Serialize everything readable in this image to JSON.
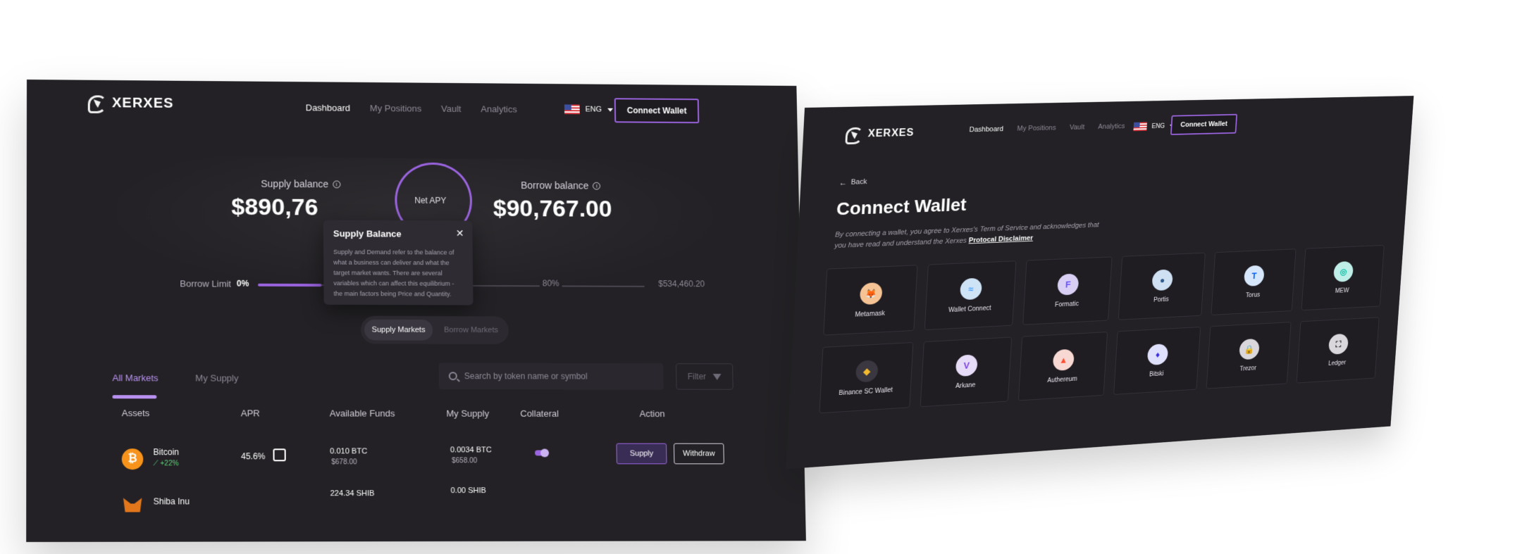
{
  "dashboard": {
    "brand": "XERXES",
    "nav": [
      "Dashboard",
      "My Positions",
      "Vault",
      "Analytics"
    ],
    "lang": "ENG",
    "connect_label": "Connect Wallet",
    "supply_balance_label": "Supply balance",
    "supply_balance_value": "$890,76",
    "net_apy_label": "Net APY",
    "borrow_balance_label": "Borrow balance",
    "borrow_balance_value": "$90,767.00",
    "borrow_limit_label": "Borrow Limit",
    "borrow_limit_pct": "0%",
    "borrow_limit_marker": "80%",
    "borrow_limit_max": "$534,460.20",
    "tooltip": {
      "title": "Supply Balance",
      "body": "Supply and Demand refer to the balance of what a business can deliver and what the target market wants. There are several variables which can affect this equilibrium - the main factors being Price and Quantity."
    },
    "market_toggle": [
      "Supply Markets",
      "Borrow Markets"
    ],
    "tabs": [
      "All Markets",
      "My Supply"
    ],
    "search_placeholder": "Search by token name or symbol",
    "filter_label": "Filter",
    "columns": [
      "Assets",
      "APR",
      "Available Funds",
      "My Supply",
      "Collateral",
      "Action"
    ],
    "rows": [
      {
        "name": "Bitcoin",
        "change": "+22%",
        "apr": "45.6%",
        "funds_token": "0.010 BTC",
        "funds_usd": "$678.00",
        "supply_token": "0.0034 BTC",
        "supply_usd": "$658.00",
        "supply_btn": "Supply",
        "withdraw_btn": "Withdraw"
      },
      {
        "name": "Shiba Inu",
        "funds_token": "224.34 SHIB",
        "supply_token": "0.00 SHIB"
      }
    ]
  },
  "connect_wallet": {
    "brand": "XERXES",
    "nav": [
      "Dashboard",
      "My Positions",
      "Vault",
      "Analytics"
    ],
    "lang": "ENG",
    "connect_label": "Connect Wallet",
    "back_label": "Back",
    "title": "Connect Wallet",
    "description": "By connecting a wallet, you agree to Xerxes's Term of Service and acknowledges that you have read and understand the Xerxes",
    "disclaimer_link": "Protocal Disclaimer",
    "wallets": [
      {
        "name": "Metamask",
        "icon": "fox-icon",
        "color": "#f5c394"
      },
      {
        "name": "Wallet Connect",
        "icon": "wave-icon",
        "color": "#cfe3f6"
      },
      {
        "name": "Formatic",
        "icon": "formatic-icon",
        "color": "#d9cff5"
      },
      {
        "name": "Portis",
        "icon": "drop-icon",
        "color": "#cfe0f2"
      },
      {
        "name": "Torus",
        "icon": "torus-icon",
        "color": "#d6e6fb"
      },
      {
        "name": "MEW",
        "icon": "mew-icon",
        "color": "#bfeee8"
      },
      {
        "name": "Binance SC Wallet",
        "icon": "binance-icon",
        "color": "#3a3740"
      },
      {
        "name": "Arkane",
        "icon": "arkane-icon",
        "color": "#e6dcf7"
      },
      {
        "name": "Authereum",
        "icon": "authereum-icon",
        "color": "#f8d8d2"
      },
      {
        "name": "Bitski",
        "icon": "bitski-icon",
        "color": "#dfe0fb"
      },
      {
        "name": "Trezor",
        "icon": "lock-icon",
        "color": "#d9d7dc"
      },
      {
        "name": "Ledger",
        "icon": "ledger-icon",
        "color": "#d9d7dc"
      }
    ]
  }
}
